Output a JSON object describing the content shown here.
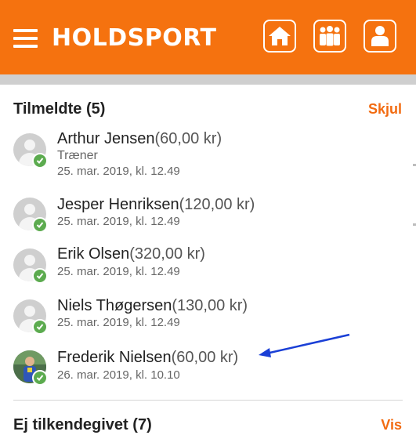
{
  "header": {
    "logo_text": "HOLDSPORT",
    "accent_color": "#f5720f",
    "buttons": [
      "home-icon",
      "team-icon",
      "profile-icon"
    ]
  },
  "signed_up": {
    "title": "Tilmeldte",
    "count": "(5)",
    "toggle_label": "Skjul",
    "members": [
      {
        "name": "Arthur Jensen",
        "amount": "(60,00 kr)",
        "role": "Træner",
        "timestamp": "25. mar. 2019, kl. 12.49"
      },
      {
        "name": "Jesper Henriksen",
        "amount": "(120,00 kr)",
        "timestamp": "25. mar. 2019, kl. 12.49"
      },
      {
        "name": "Erik Olsen",
        "amount": "(320,00 kr)",
        "timestamp": "25. mar. 2019, kl. 12.49"
      },
      {
        "name": "Niels Thøgersen",
        "amount": "(130,00 kr)",
        "timestamp": "25. mar. 2019, kl. 12.49"
      },
      {
        "name": "Frederik Nielsen",
        "amount": "(60,00 kr)",
        "timestamp": "26. mar. 2019, kl. 10.10"
      }
    ]
  },
  "undecided": {
    "title": "Ej tilkendegivet",
    "count": "(7)",
    "toggle_label": "Vis"
  }
}
